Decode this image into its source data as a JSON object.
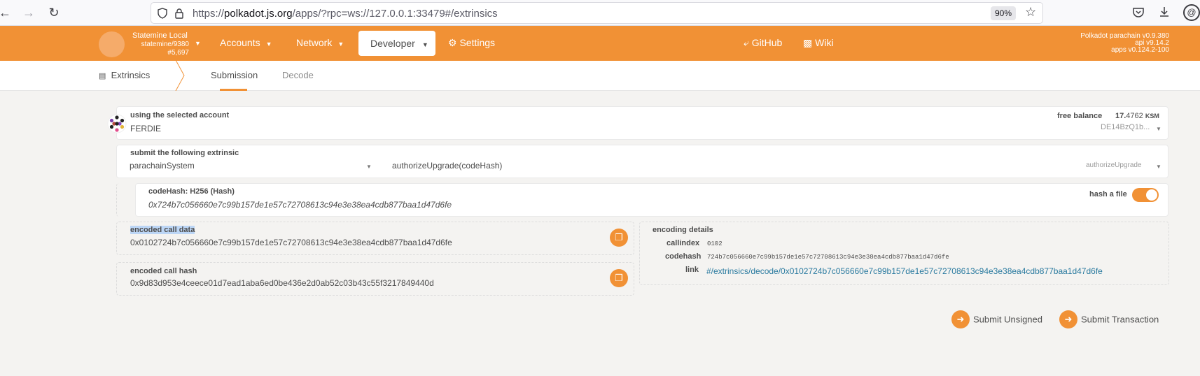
{
  "browser": {
    "url_prefix": "https://",
    "url_domain": "polkadot.js.org",
    "url_rest": "/apps/?rpc=ws://127.0.0.1:33479#/extrinsics",
    "zoom": "90%"
  },
  "header": {
    "chain_name": "Statemine Local",
    "chain_spec": "statemine/9380",
    "block": "#5,697",
    "nav": {
      "accounts": "Accounts",
      "network": "Network",
      "developer": "Developer",
      "settings": "Settings",
      "github": "GitHub",
      "wiki": "Wiki"
    },
    "versions": {
      "node": "Polkadot parachain v0.9.380",
      "api": "api v9.14.2",
      "apps": "apps v0.124.2-100"
    },
    "accent_color": "#f19135"
  },
  "subnav": {
    "section": "Extrinsics",
    "tabs": [
      "Submission",
      "Decode"
    ],
    "active_tab": "Submission"
  },
  "account": {
    "label": "using the selected account",
    "name": "FERDIE",
    "balance_label": "free balance",
    "balance_int": "17.",
    "balance_frac": "4762",
    "balance_unit": "KSM",
    "address_short": "DE14BzQ1b..."
  },
  "extrinsic": {
    "label": "submit the following extrinsic",
    "pallet": "parachainSystem",
    "call": "authorizeUpgrade(codeHash)",
    "call_short": "authorizeUpgrade"
  },
  "param": {
    "label": "codeHash: H256 (Hash)",
    "value": "0x724b7c056660e7c99b157de1e57c72708613c94e3e38ea4cdb877baa1d47d6fe",
    "hash_file_label": "hash a file",
    "hash_file_on": true
  },
  "encoded": {
    "call_data_label": "encoded call data",
    "call_data": "0x0102724b7c056660e7c99b157de1e57c72708613c94e3e38ea4cdb877baa1d47d6fe",
    "call_hash_label": "encoded call hash",
    "call_hash": "0x9d83d953e4ceece01d7ead1aba6ed0be436e2d0ab52c03b43c55f3217849440d"
  },
  "details": {
    "label": "encoding details",
    "callindex_label": "callindex",
    "callindex": "0102",
    "codehash_label": "codehash",
    "codehash": "724b7c056660e7c99b157de1e57c72708613c94e3e38ea4cdb877baa1d47d6fe",
    "link_label": "link",
    "link": "#/extrinsics/decode/0x0102724b7c056660e7c99b157de1e57c72708613c94e3e38ea4cdb877baa1d47d6fe"
  },
  "actions": {
    "submit_unsigned": "Submit Unsigned",
    "submit_transaction": "Submit Transaction"
  }
}
